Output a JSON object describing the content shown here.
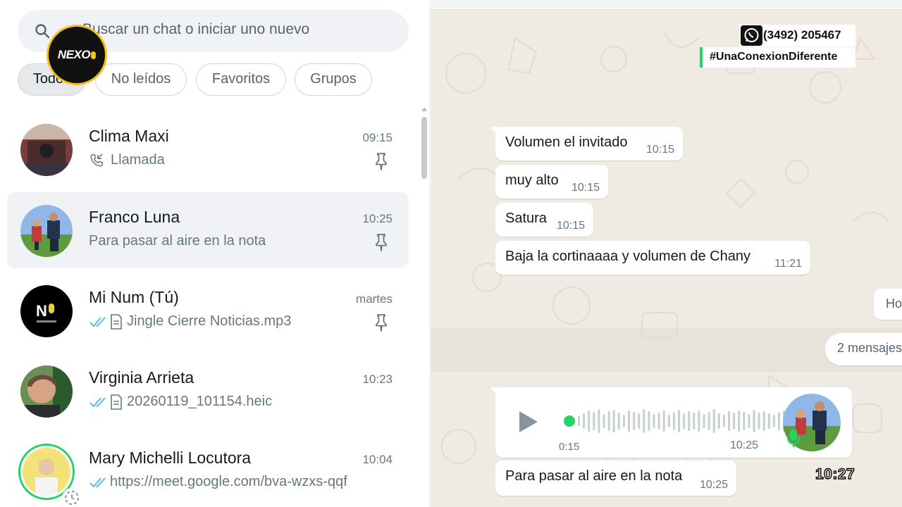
{
  "search": {
    "placeholder": "Buscar un chat o iniciar uno nuevo",
    "icon": "search-icon"
  },
  "logo": {
    "text": "NEXO"
  },
  "filters": [
    {
      "label": "Todos",
      "active": true
    },
    {
      "label": "No leídos",
      "active": false
    },
    {
      "label": "Favoritos",
      "active": false
    },
    {
      "label": "Grupos",
      "active": false
    }
  ],
  "chats": [
    {
      "name": "Clima Maxi",
      "time": "09:15",
      "preview": "Llamada",
      "pinned": true
    },
    {
      "name": "Franco Luna",
      "time": "10:25",
      "preview": "Para pasar al aire en la nota",
      "pinned": true,
      "selected": true
    },
    {
      "name": "Mi Num (Tú)",
      "time": "martes",
      "preview": "Jingle Cierre Noticias.mp3",
      "pinned": true
    },
    {
      "name": "Virginia Arrieta",
      "time": "10:23",
      "preview": "20260119_101154.heic"
    },
    {
      "name": "Mary Michelli Locutora",
      "time": "10:04",
      "preview": "https://meet.google.com/bva-wzxs-qqf"
    }
  ],
  "conversation": {
    "messages": [
      {
        "text": "Volumen el invitado",
        "time": "10:15"
      },
      {
        "text": "muy alto",
        "time": "10:15"
      },
      {
        "text": "Satura",
        "time": "10:15"
      },
      {
        "text": "Baja la cortinaaaa y volumen de Chany",
        "time": "11:21"
      }
    ],
    "system_today": "Ho",
    "system_unread": "2 mensajes",
    "audio": {
      "duration": "0:15",
      "time": "10:25",
      "progress": 0
    },
    "last_message": {
      "text": "Para pasar al aire en la nota",
      "time": "10:25"
    }
  },
  "overlay": {
    "phone": "(3492) 205467",
    "hashtag": "#UnaConexionDiferente",
    "clock": "10:27"
  },
  "colors": {
    "accent": "#25d366",
    "chat_bg": "#efeae2",
    "logo_ring": "#f2c21b"
  }
}
